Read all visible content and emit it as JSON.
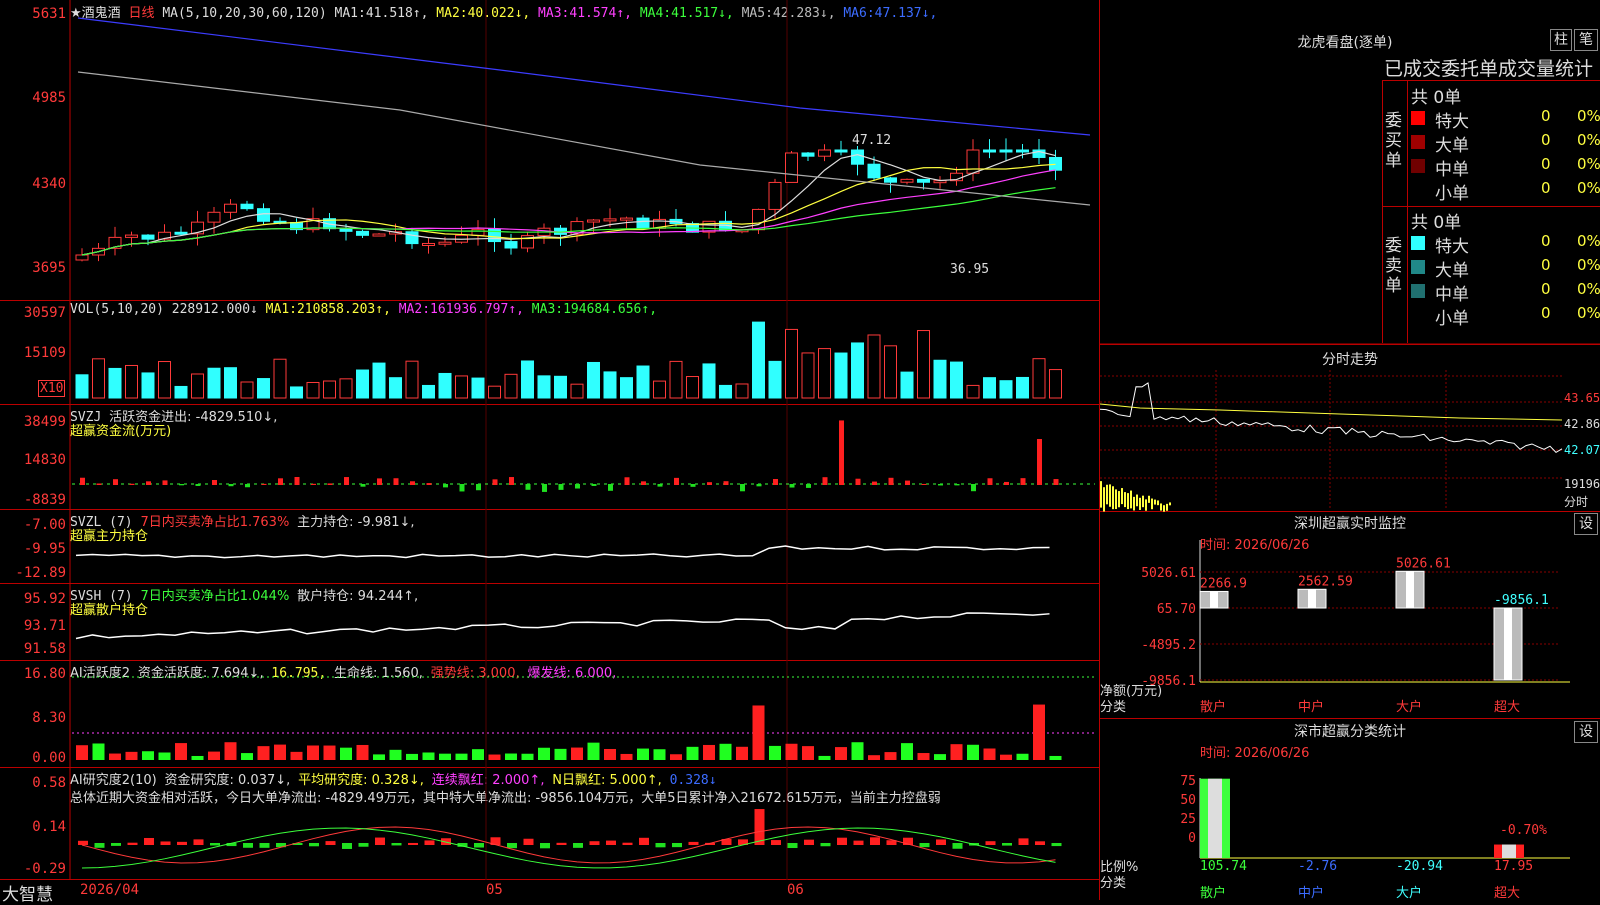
{
  "main": {
    "title": "★酒鬼酒",
    "period": "日线",
    "ma_label": "MA(5,10,20,30,60,120)",
    "ma": [
      {
        "label": "MA1:",
        "value": "41.518↑",
        "color": "#ddd"
      },
      {
        "label": "MA2:",
        "value": "40.022↓",
        "color": "#ffff40"
      },
      {
        "label": "MA3:",
        "value": "41.574↑",
        "color": "#ff40ff"
      },
      {
        "label": "MA4:",
        "value": "41.517↓",
        "color": "#3cff3c"
      },
      {
        "label": "MA5:",
        "value": "42.283↓",
        "color": "#bbb"
      },
      {
        "label": "MA6:",
        "value": "47.137↓",
        "color": "#3c6cff"
      }
    ],
    "y_ticks": [
      "5631",
      "4985",
      "4340",
      "3695"
    ],
    "high_label": "47.12",
    "low_label": "36.95"
  },
  "vol": {
    "label": "VOL(5,10,20)",
    "value": "228912.000↓",
    "ma": [
      {
        "label": "MA1:",
        "value": "210858.203↑",
        "color": "#ffff40"
      },
      {
        "label": "MA2:",
        "value": "161936.797↑",
        "color": "#ff40ff"
      },
      {
        "label": "MA3:",
        "value": "194684.656↑",
        "color": "#3cff3c"
      }
    ],
    "y_ticks": [
      "30597",
      "15109"
    ],
    "unit": "X10"
  },
  "svzj": {
    "label": "SVZJ",
    "text": "活跃资金进出: -4829.510↓,",
    "title": "超赢资金流(万元)",
    "y_ticks": [
      "38499",
      "14830",
      "-8839"
    ]
  },
  "svzl": {
    "label": "SVZL (7)",
    "text1": "7日内买卖净占比1.763%",
    "text2": "主力持仓: -9.981↓,",
    "title": "超赢主力持仓",
    "y_ticks": [
      "-7.00",
      "-9.95",
      "-12.89"
    ]
  },
  "svsh": {
    "label": "SVSH (7)",
    "text1": "7日内买卖净占比1.044%",
    "text2": "散户持仓: 94.244↑,",
    "title": "超赢散户持仓",
    "y_ticks": [
      "95.92",
      "93.71",
      "91.58"
    ]
  },
  "ai1": {
    "label": "AI活跃度2",
    "text": "资金活跃度: 7.694↓,",
    "v2": "16.795,",
    "v3": "生命线: 1.560,",
    "v4": "强势线: 3.000,",
    "v5": "爆发线: 6.000,",
    "y_ticks": [
      "16.80",
      "8.30",
      "0.00"
    ]
  },
  "ai2": {
    "label": "AI研究度2(10)",
    "text": "资金研究度: 0.037↓,",
    "v2": "平均研究度: 0.328↓,",
    "v3": "连续飘红: 2.000↑,",
    "v4": "N日飘红: 5.000↑,",
    "v5": "0.328↓",
    "summary": "总体近期大资金相对活跃，今日大单净流出: -4829.49万元，其中特大单净流出: -9856.104万元，大单5日累计净入21672.615万元，当前主力控盘弱",
    "y_ticks": [
      "0.58",
      "0.14",
      "-0.29"
    ]
  },
  "footer": {
    "brand": "大智慧",
    "dates": [
      "2026/04",
      "05",
      "06"
    ]
  },
  "longhu": {
    "title": "龙虎看盘(逐单)",
    "btn_zhu": "柱",
    "btn_bi": "笔",
    "subtitle": "已成交委托单成交量统计",
    "buy_label": "委买单",
    "sell_label": "委卖单",
    "buy_total": "共 0单",
    "sell_total": "共 0单",
    "buy_rows": [
      {
        "name": "特大",
        "count": "0",
        "pct": "0%",
        "color": "#ff0000"
      },
      {
        "name": "大单",
        "count": "0",
        "pct": "0%",
        "color": "#a00000"
      },
      {
        "name": "中单",
        "count": "0",
        "pct": "0%",
        "color": "#700000"
      },
      {
        "name": "小单",
        "count": "0",
        "pct": "0%",
        "color": ""
      }
    ],
    "sell_rows": [
      {
        "name": "特大",
        "count": "0",
        "pct": "0%",
        "color": "#30ffff"
      },
      {
        "name": "大单",
        "count": "0",
        "pct": "0%",
        "color": "#208888"
      },
      {
        "name": "中单",
        "count": "0",
        "pct": "0%",
        "color": "#207070"
      },
      {
        "name": "小单",
        "count": "0",
        "pct": "0%",
        "color": ""
      }
    ]
  },
  "fenshi": {
    "title": "分时走势",
    "y_ticks": [
      "43.65",
      "42.86",
      "42.07"
    ],
    "vol_tick": "19196",
    "vol_unit": "分时"
  },
  "monitor": {
    "title": "深圳超赢实时监控",
    "btn": "设",
    "time": "时间: 2026/06/26",
    "y_ticks": [
      "5026.61",
      "65.70",
      "-4895.2",
      "-9856.1"
    ],
    "ylabel": "净额(万元)",
    "xlabel": "分类",
    "bars": [
      {
        "label": "2266.9",
        "value": 2266.9
      },
      {
        "label": "2562.59",
        "value": 2562.59
      },
      {
        "label": "5026.61",
        "value": 5026.61
      },
      {
        "label": "-9856.1",
        "value": -9856.1
      }
    ],
    "categories": [
      "散户",
      "中户",
      "大户",
      "超大"
    ]
  },
  "classify": {
    "title": "深市超赢分类统计",
    "btn": "设",
    "time": "时间: 2026/06/26",
    "y_ticks": [
      "75",
      "50",
      "25",
      "0"
    ],
    "ylabel": "比例%",
    "xlabel": "分类",
    "bars": [
      {
        "value": 105.74,
        "label": "105.74"
      },
      {
        "value": -2.76,
        "label": "-2.76"
      },
      {
        "value": -20.94,
        "label": "-20.94"
      },
      {
        "value": 17.95,
        "label": "17.95"
      }
    ],
    "extra_label": "-0.70%",
    "categories": [
      "散户",
      "中户",
      "大户",
      "超大"
    ]
  }
}
